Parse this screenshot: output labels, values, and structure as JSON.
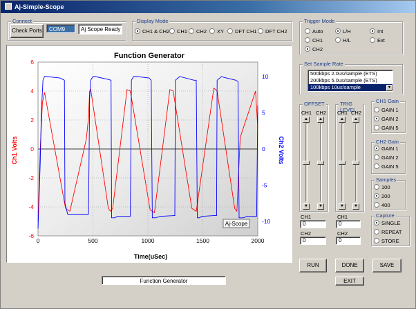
{
  "window": {
    "title": "Aj-Simple-Scope"
  },
  "connect": {
    "label": "Connect",
    "check_ports_label": "Check Ports",
    "port_value": "COM9",
    "status_value": "Aj Scope Ready"
  },
  "display_mode": {
    "label": "Display Mode",
    "options": [
      "CH1 & CH2",
      "CH1",
      "CH2",
      "XY",
      "DFT CH1",
      "DFT CH2"
    ],
    "selected": "CH1 & CH2"
  },
  "trigger_mode": {
    "label": "Trigger Mode",
    "col1": [
      "Auto",
      "CH1",
      "CH2"
    ],
    "col2": [
      "L/H",
      "H/L"
    ],
    "col3": [
      "Int",
      "Ext"
    ],
    "selected": [
      "CH2",
      "L/H",
      "Int"
    ]
  },
  "sample_rate": {
    "label": "Set Sample Rate",
    "items": [
      "500kbps 2.0us/sample (ETS)",
      "200kbps 5.0us/sample (ETS)",
      "100kbps 10us/sample"
    ],
    "selected": "100kbps 10us/sample"
  },
  "offset": {
    "label": "OFFSET",
    "ch1_label": "CH1",
    "ch2_label": "CH2"
  },
  "trig_level": {
    "label": "TRIG LEVEL",
    "ch1_label": "CH1",
    "ch2_label": "CH2"
  },
  "ch_values": {
    "offset_ch1_label": "CH1",
    "offset_ch1_value": "0",
    "offset_ch2_label": "CH2",
    "offset_ch2_value": "0",
    "trig_ch1_label": "CH1",
    "trig_ch1_value": "0",
    "trig_ch2_label": "CH2",
    "trig_ch2_value": "0"
  },
  "ch1_gain": {
    "label": "CH1 Gain",
    "options": [
      "GAIN 1",
      "GAIN 2",
      "GAIN 5"
    ],
    "selected": "GAIN 2"
  },
  "ch2_gain": {
    "label": "CH2 Gain",
    "options": [
      "GAIN 1",
      "GAIN 2",
      "GAIN 5"
    ],
    "selected": "GAIN 1"
  },
  "samples": {
    "label": "Samples",
    "options": [
      "100",
      "200",
      "400"
    ],
    "selected": "200"
  },
  "capture": {
    "label": "Capture",
    "options": [
      "SINGLE",
      "REPEAT",
      "STORE"
    ],
    "selected": "SINGLE"
  },
  "buttons": {
    "run": "RUN",
    "done": "DONE",
    "save": "SAVE",
    "exit": "EXIT"
  },
  "status_bar": {
    "text": "Function Generator"
  },
  "colors": {
    "ch1": "#ff0000",
    "ch2": "#0000ff",
    "title_bar": "#0a246a"
  },
  "chart_data": {
    "type": "line",
    "title": "Function Generator",
    "xlabel": "Time(uSec)",
    "ylabel_left": "Ch1 Volts",
    "ylabel_right": "Ch2 Volts",
    "xlim": [
      0,
      2000
    ],
    "ylim_left": [
      -6,
      6
    ],
    "ylim_right": [
      -12,
      12
    ],
    "xticks": [
      0,
      500,
      1000,
      1500,
      2000
    ],
    "yticks_left": [
      -6,
      -4,
      -2,
      0,
      2,
      4,
      6
    ],
    "yticks_right": [
      -10,
      -5,
      0,
      5,
      10
    ],
    "annotation": "Aj-Scope",
    "grid": true,
    "series": [
      {
        "axis": "left",
        "color": "#ff0000",
        "x": [
          0,
          20,
          40,
          60,
          250,
          290,
          440,
          460,
          470,
          480,
          640,
          660,
          680,
          810,
          840,
          1020,
          1060,
          1200,
          1230,
          1400,
          1440,
          1600,
          1630,
          1790,
          1810,
          1840,
          1980,
          2000
        ],
        "y": [
          -5,
          0,
          3.2,
          3.9,
          -4.1,
          -4.3,
          0.7,
          2.2,
          4.0,
          4.1,
          -4.1,
          -4.3,
          -4.1,
          4.1,
          4.0,
          -4.2,
          -4.4,
          4.1,
          4.0,
          -4.1,
          -4.3,
          4.2,
          4.0,
          -4.1,
          -4.3,
          0.8,
          4.0,
          1.5
        ]
      },
      {
        "axis": "right",
        "color": "#0000ff",
        "x": [
          0,
          20,
          30,
          45,
          60,
          80,
          200,
          240,
          245,
          270,
          290,
          330,
          460,
          470,
          480,
          500,
          520,
          640,
          665,
          670,
          700,
          720,
          810,
          840,
          850,
          870,
          900,
          1010,
          1030,
          1040,
          1070,
          1110,
          1240,
          1245,
          1250,
          1290,
          1420,
          1440,
          1450,
          1470,
          1490,
          1600,
          1625,
          1630,
          1670,
          1690,
          1800,
          1820,
          1830,
          1870,
          1900,
          1990,
          2000
        ],
        "y": [
          -11,
          -2,
          5,
          9.5,
          10,
          10,
          9.8,
          9.5,
          -7.5,
          -9,
          -9,
          -9,
          -9,
          7,
          9.5,
          10,
          10,
          9.6,
          9.5,
          -9.5,
          -9.5,
          -9.3,
          -9.3,
          -9.3,
          9.5,
          10,
          10,
          9.8,
          9.5,
          -9.5,
          -9.5,
          -9.3,
          -9.2,
          -9.2,
          9.5,
          10,
          9.5,
          9.5,
          -9.5,
          -9.5,
          -9.3,
          -9.2,
          -9.2,
          9.5,
          10,
          9.9,
          9.5,
          9.3,
          -9.5,
          -9.5,
          -9.3,
          -9.3,
          6
        ]
      }
    ]
  }
}
